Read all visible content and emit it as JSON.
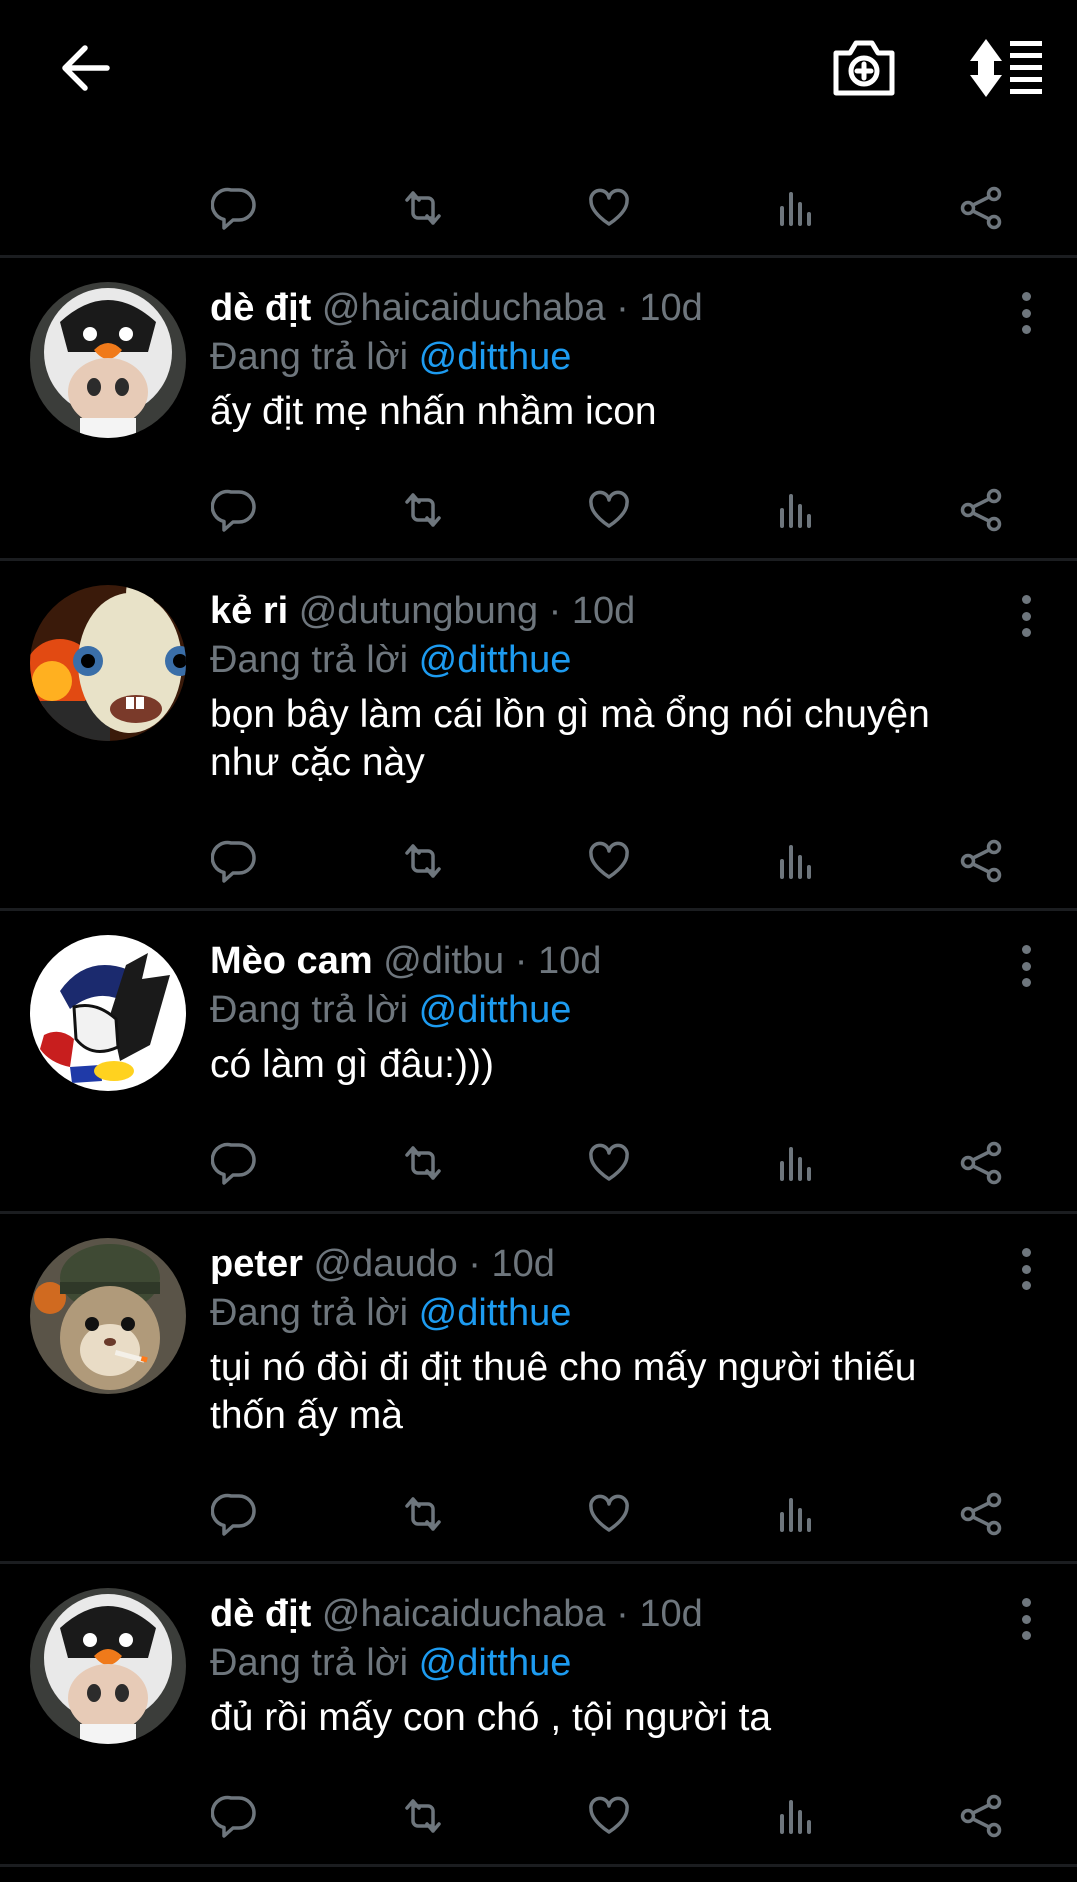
{
  "header": {
    "back_icon": "arrow-left-icon",
    "camera_icon": "camera-plus-icon",
    "sort_icon": "sort-list-icon"
  },
  "actions_icons": [
    "reply-icon",
    "retweet-icon",
    "like-icon",
    "views-icon",
    "share-icon"
  ],
  "tweets": [
    {
      "name": "dè địt",
      "handle": "@haicaiduchaba",
      "time": "10d",
      "reply_prefix": "Đang trả lời",
      "reply_to": "@ditthue",
      "text": "ấy địt mẹ nhấn nhầm icon"
    },
    {
      "name": "kẻ ri",
      "handle": "@dutungbung",
      "time": "10d",
      "reply_prefix": "Đang trả lời",
      "reply_to": "@ditthue",
      "text": "bọn bây làm cái lồn gì mà ổng nói chuyện như cặc này"
    },
    {
      "name": "Mèo cam",
      "handle": "@ditbu",
      "time": "10d",
      "reply_prefix": "Đang trả lời",
      "reply_to": "@ditthue",
      "text": "có làm gì đâu:)))"
    },
    {
      "name": "peter",
      "handle": "@daudo",
      "time": "10d",
      "reply_prefix": "Đang trả lời",
      "reply_to": "@ditthue",
      "text": "tụi nó đòi đi địt thuê cho mấy người thiếu thốn ấy mà"
    },
    {
      "name": "dè địt",
      "handle": "@haicaiduchaba",
      "time": "10d",
      "reply_prefix": "Đang trả lời",
      "reply_to": "@ditthue",
      "text": "đủ rồi mấy con chó , tội người ta"
    }
  ],
  "colors": {
    "background": "#000000",
    "secondary_text": "#6e767d",
    "mention": "#1d9bf0",
    "divider": "#1b1d20"
  }
}
